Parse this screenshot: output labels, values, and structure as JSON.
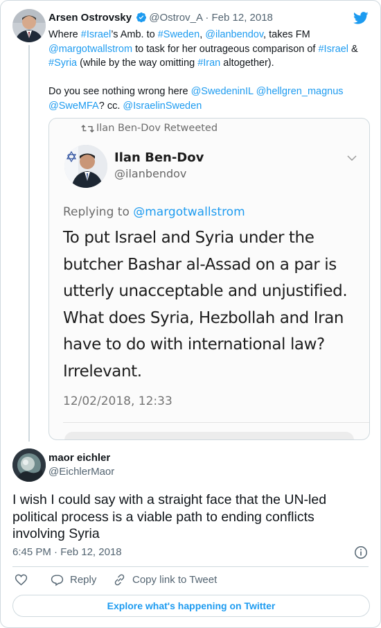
{
  "tweet": {
    "author_name": "Arsen Ostrovsky",
    "author_handle": "@Ostrov_A",
    "date_sep": " · ",
    "date": "Feb 12, 2018",
    "text_parts": [
      {
        "t": "Where ",
        "link": false
      },
      {
        "t": "#Israel",
        "link": true
      },
      {
        "t": "’s Amb. to ",
        "link": false
      },
      {
        "t": "#Sweden",
        "link": true
      },
      {
        "t": ", ",
        "link": false
      },
      {
        "t": "@ilanbendov",
        "link": true
      },
      {
        "t": ", takes FM ",
        "link": false
      },
      {
        "t": "@margotwallstrom",
        "link": true
      },
      {
        "t": " to task for her outrageous comparison of ",
        "link": false
      },
      {
        "t": "#Israel",
        "link": true
      },
      {
        "t": " & ",
        "link": false
      },
      {
        "t": "#Syria",
        "link": true
      },
      {
        "t": " (while by the way omitting ",
        "link": false
      },
      {
        "t": "#Iran",
        "link": true
      },
      {
        "t": " altogether).",
        "link": false
      }
    ],
    "text_parts_2": [
      {
        "t": "Do you see nothing wrong here ",
        "link": false
      },
      {
        "t": "@SwedeninIL",
        "link": true
      },
      {
        "t": " ",
        "link": false
      },
      {
        "t": "@hellgren_magnus",
        "link": true
      },
      {
        "t": " ",
        "link": false
      },
      {
        "t": "@SweMFA",
        "link": true
      },
      {
        "t": "? cc. ",
        "link": false
      },
      {
        "t": "@IsraelinSweden",
        "link": true
      }
    ]
  },
  "embedded": {
    "retweet_label": "Ilan Ben-Dov Retweeted",
    "name": "Ilan Ben-Dov",
    "handle": "@ilanbendov",
    "replying_prefix": "Replying to ",
    "replying_to": "@margotwallstrom",
    "body_lines": [
      "To put Israel and Syria under the",
      "butcher Bashar al-Assad on a par is",
      "utterly unacceptable and unjustified.",
      "What does Syria, Hezbollah and Iran",
      "have to do with international law?",
      "Irrelevant."
    ],
    "timestamp": "12/02/2018, 12:33"
  },
  "reply": {
    "name": "maor eichler",
    "handle": "@EichlerMaor",
    "text": "I wish I could say with a straight face that the UN-led political process is a viable path to ending conflicts involving Syria",
    "time": "6:45 PM",
    "date_sep": " · ",
    "date": "Feb 12, 2018"
  },
  "actions": {
    "reply_label": "Reply",
    "copy_label": "Copy link to Tweet"
  },
  "explore_label": "Explore what's happening on Twitter",
  "icons": {
    "brand": "twitter-bird-icon",
    "verified": "verified-badge-icon",
    "retweet": "retweet-icon",
    "like": "heart-icon",
    "reply": "reply-bubble-icon",
    "copy": "link-icon",
    "info": "info-icon"
  },
  "colors": {
    "link": "#1d9bf0",
    "text": "#0f1419",
    "muted": "#536471",
    "border": "#cfd9de"
  }
}
